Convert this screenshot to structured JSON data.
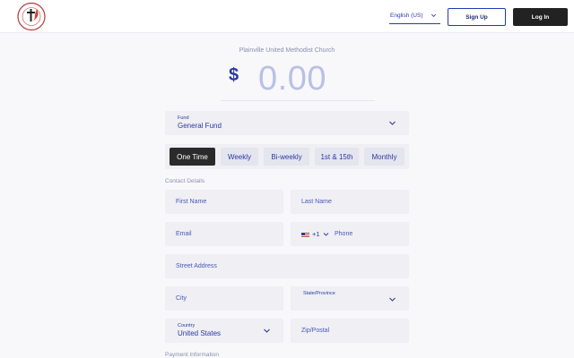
{
  "header": {
    "logo_alt": "Plainville United Methodist Church logo",
    "language": "English (US)",
    "sign_up": "Sign Up",
    "log_in": "Log In"
  },
  "donation": {
    "church_name": "Plainville United Methodist Church",
    "currency_symbol": "$",
    "amount": "0.00",
    "fund_label": "Fund",
    "fund_value": "General Fund",
    "frequencies": [
      "One Time",
      "Weekly",
      "Bi-weekly",
      "1st & 15th",
      "Monthly"
    ],
    "selected_frequency": "One Time"
  },
  "contact": {
    "section_title": "Contact Details",
    "first_name": "First Name",
    "last_name": "Last Name",
    "email": "Email",
    "phone_code": "+1",
    "phone": "Phone",
    "street": "Street Address",
    "city": "City",
    "state_label": "State/Province",
    "country_label": "Country",
    "country_value": "United States",
    "zip": "Zip/Postal"
  },
  "payment": {
    "section_title": "Payment Information"
  },
  "colors": {
    "accent": "#2b3aa0",
    "field_bg": "#efeff4",
    "dark_button": "#222222",
    "amount_placeholder": "#b9c0e6"
  }
}
